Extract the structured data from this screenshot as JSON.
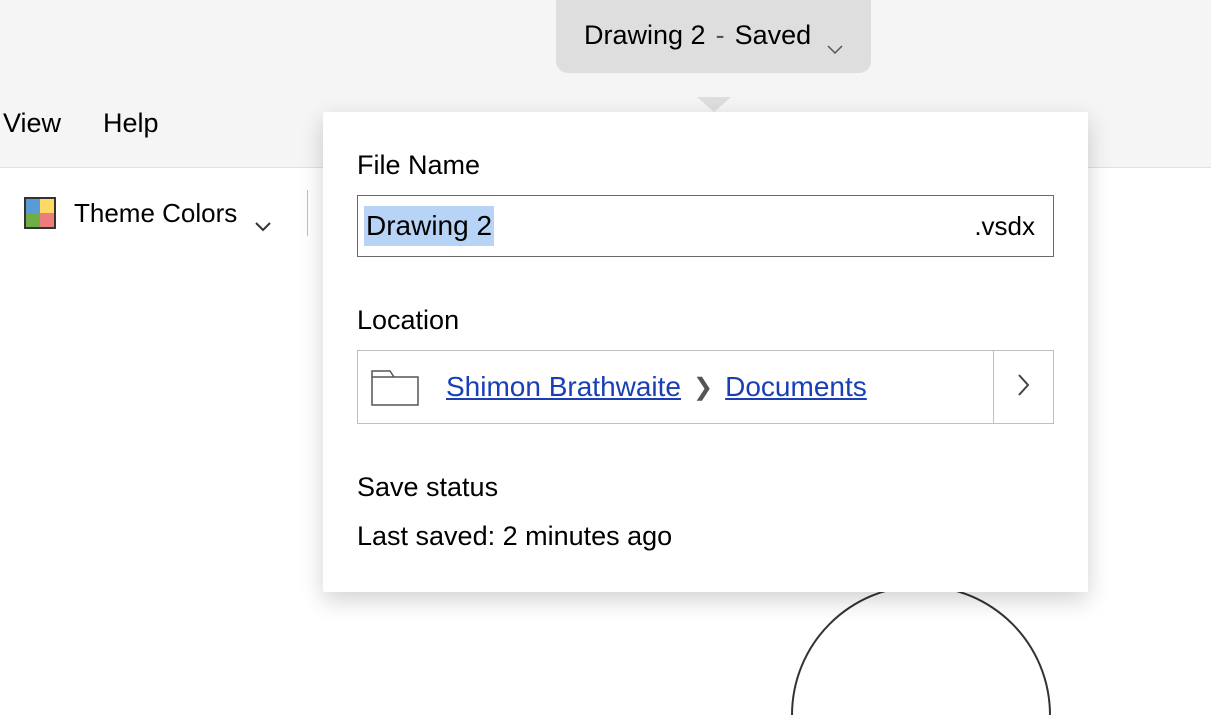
{
  "title": {
    "document_name": "Drawing 2",
    "separator": "-",
    "status": "Saved"
  },
  "menu": {
    "view": "View",
    "help": "Help"
  },
  "toolbar": {
    "theme_colors_label": "Theme Colors"
  },
  "popover": {
    "filename_label": "File Name",
    "filename_value": "Drawing 2",
    "extension": ".vsdx",
    "location_label": "Location",
    "breadcrumb": {
      "owner": "Shimon Brathwaite",
      "folder": "Documents"
    },
    "save_status_label": "Save status",
    "save_status_value": "Last saved: 2 minutes ago"
  }
}
